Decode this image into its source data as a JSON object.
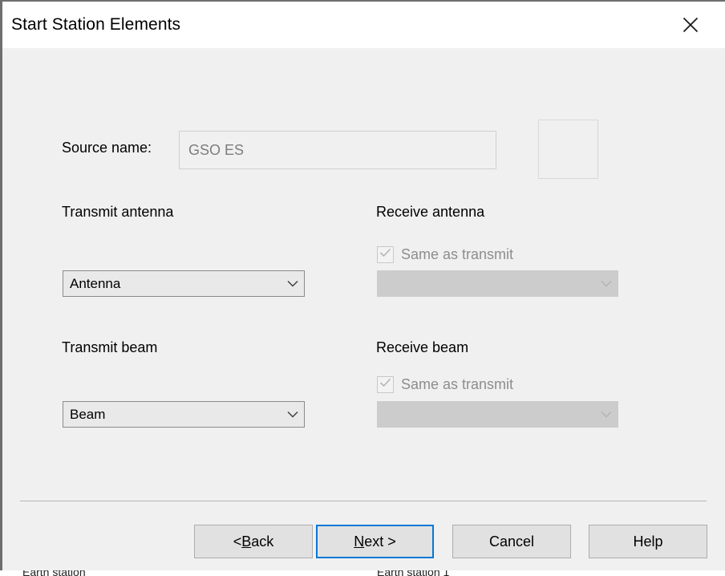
{
  "window": {
    "title": "Start Station Elements",
    "close_icon": "close-icon"
  },
  "form": {
    "source_name_label": "Source name:",
    "source_name_value": "GSO ES",
    "source_name_placeholder": "",
    "preview_box_label": ""
  },
  "sections": {
    "transmit_antenna": {
      "heading": "Transmit antenna",
      "combo_value": "Antenna",
      "chevron_icon": "chevron-down-icon"
    },
    "receive_antenna": {
      "heading": "Receive antenna",
      "same_as_transmit_label": "Same as transmit",
      "same_as_transmit_checked": true,
      "check_icon": "check-icon",
      "combo_value": "",
      "chevron_icon": "chevron-down-icon"
    },
    "transmit_beam": {
      "heading": "Transmit beam",
      "combo_value": "Beam",
      "chevron_icon": "chevron-down-icon"
    },
    "receive_beam": {
      "heading": "Receive beam",
      "same_as_transmit_label": "Same as transmit",
      "same_as_transmit_checked": true,
      "check_icon": "check-icon",
      "combo_value": "",
      "chevron_icon": "chevron-down-icon"
    }
  },
  "buttons": {
    "back": {
      "prefix": "< ",
      "accel": "B",
      "rest": "ack"
    },
    "next": {
      "prefix": "",
      "accel": "N",
      "rest": "ext >"
    },
    "cancel": {
      "label": "Cancel"
    },
    "help": {
      "label": "Help"
    }
  },
  "background_window": {
    "column_left_clipped": "Earth station",
    "column_right_clipped": "Earth station 1"
  },
  "colors": {
    "accent_focus": "#0078d7",
    "dialog_bg": "#f0f0f0",
    "titlebar_bg": "#ffffff",
    "disabled_control": "#cccccc",
    "disabled_text": "#8d8d8d"
  }
}
